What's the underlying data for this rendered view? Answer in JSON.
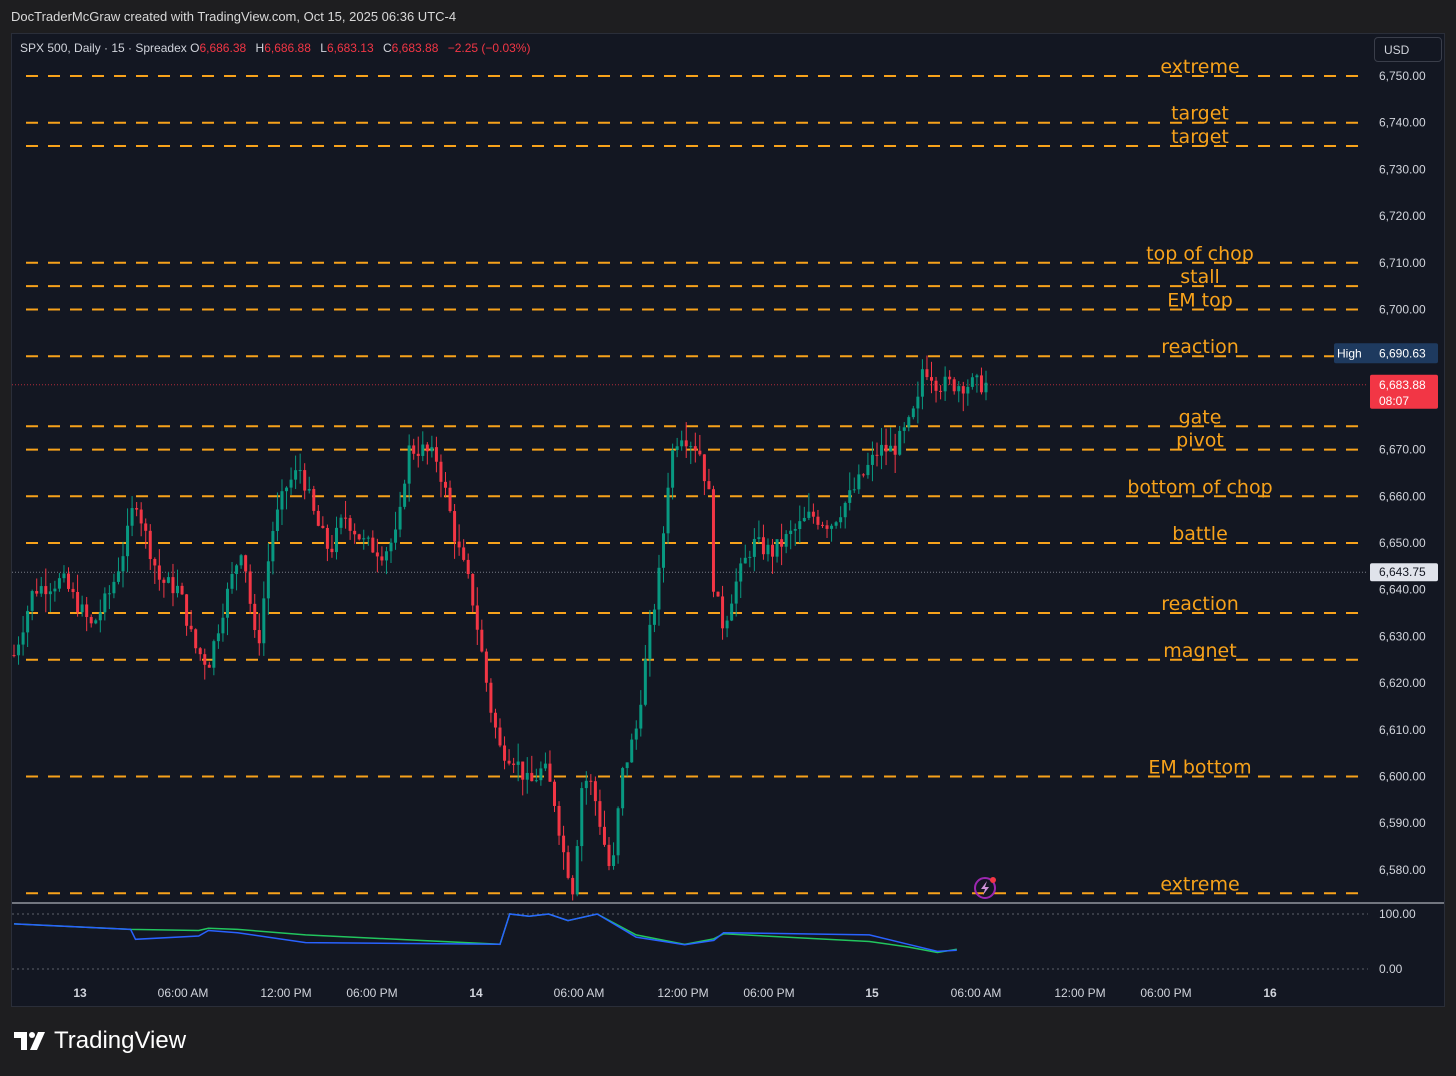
{
  "header": {
    "credit": "DocTraderMcGraw created with TradingView.com, Oct 15, 2025 06:36 UTC-4"
  },
  "legend": {
    "symbol": "SPX 500, Daily · 15 · Spreadex",
    "o_label": "O",
    "o_value": "6,686.38",
    "h_label": "H",
    "h_value": "6,686.88",
    "l_label": "L",
    "l_value": "6,683.13",
    "c_label": "C",
    "c_value": "6,683.88",
    "change": "−2.25 (−0.03%)"
  },
  "currency_button": "USD",
  "footer": {
    "brand": "TradingView"
  },
  "colors": {
    "level_line": "#f7a21b",
    "up_candle": "#089981",
    "down_candle": "#f23645",
    "osc_green": "#22c55e",
    "osc_blue": "#2962ff",
    "high_badge": "#1e3a5f",
    "last_badge": "#f23645"
  },
  "chart_data": {
    "type": "candlestick",
    "title": "SPX 500, Daily · 15 · Spreadex",
    "y_axis": {
      "ticks": [
        "6,750.00",
        "6,740.00",
        "6,730.00",
        "6,720.00",
        "6,710.00",
        "6,700.00",
        "6,690.00",
        "6,680.00",
        "6,670.00",
        "6,660.00",
        "6,650.00",
        "6,640.00",
        "6,630.00",
        "6,620.00",
        "6,610.00",
        "6,600.00",
        "6,590.00",
        "6,580.00"
      ],
      "range": [
        6574,
        6753
      ]
    },
    "x_axis": {
      "ticks": [
        "13",
        "06:00 AM",
        "12:00 PM",
        "06:00 PM",
        "14",
        "06:00 AM",
        "12:00 PM",
        "06:00 PM",
        "15",
        "06:00 AM",
        "12:00 PM",
        "06:00 PM",
        "16"
      ]
    },
    "levels": [
      {
        "label": "extreme",
        "price": 6750
      },
      {
        "label": "target",
        "price": 6740
      },
      {
        "label": "target",
        "price": 6735
      },
      {
        "label": "top of chop",
        "price": 6710
      },
      {
        "label": "stall",
        "price": 6705
      },
      {
        "label": "EM top",
        "price": 6700
      },
      {
        "label": "reaction",
        "price": 6690
      },
      {
        "label": "gate",
        "price": 6675
      },
      {
        "label": "pivot",
        "price": 6670
      },
      {
        "label": "bottom of chop",
        "price": 6660
      },
      {
        "label": "battle",
        "price": 6650
      },
      {
        "label": "reaction",
        "price": 6635
      },
      {
        "label": "magnet",
        "price": 6625
      },
      {
        "label": "EM bottom",
        "price": 6600
      },
      {
        "label": "extreme",
        "price": 6575
      }
    ],
    "price_path": [
      [
        0,
        6626
      ],
      [
        0.02,
        6640
      ],
      [
        0.05,
        6642
      ],
      [
        0.08,
        6632
      ],
      [
        0.1,
        6640
      ],
      [
        0.115,
        6650
      ],
      [
        0.125,
        6660
      ],
      [
        0.135,
        6652
      ],
      [
        0.15,
        6642
      ],
      [
        0.17,
        6640
      ],
      [
        0.185,
        6628
      ],
      [
        0.2,
        6624
      ],
      [
        0.215,
        6636
      ],
      [
        0.235,
        6650
      ],
      [
        0.25,
        6626
      ],
      [
        0.265,
        6652
      ],
      [
        0.28,
        6662
      ],
      [
        0.295,
        6666
      ],
      [
        0.31,
        6655
      ],
      [
        0.325,
        6648
      ],
      [
        0.34,
        6656
      ],
      [
        0.36,
        6650
      ],
      [
        0.38,
        6648
      ],
      [
        0.395,
        6652
      ],
      [
        0.405,
        6670
      ],
      [
        0.42,
        6670
      ],
      [
        0.435,
        6668
      ],
      [
        0.445,
        6660
      ],
      [
        0.455,
        6650
      ],
      [
        0.47,
        6640
      ],
      [
        0.48,
        6628
      ],
      [
        0.49,
        6615
      ],
      [
        0.5,
        6606
      ],
      [
        0.515,
        6604
      ],
      [
        0.53,
        6598
      ],
      [
        0.545,
        6602
      ],
      [
        0.555,
        6596
      ],
      [
        0.565,
        6584
      ],
      [
        0.575,
        6576
      ],
      [
        0.585,
        6600
      ],
      [
        0.595,
        6598
      ],
      [
        0.605,
        6588
      ],
      [
        0.615,
        6578
      ],
      [
        0.625,
        6600
      ],
      [
        0.64,
        6610
      ],
      [
        0.65,
        6625
      ],
      [
        0.665,
        6645
      ],
      [
        0.675,
        6668
      ],
      [
        0.685,
        6674
      ],
      [
        0.695,
        6672
      ],
      [
        0.705,
        6670
      ],
      [
        0.715,
        6660
      ],
      [
        0.72,
        6640
      ],
      [
        0.73,
        6632
      ],
      [
        0.74,
        6640
      ],
      [
        0.76,
        6650
      ],
      [
        0.78,
        6648
      ],
      [
        0.8,
        6652
      ],
      [
        0.82,
        6656
      ],
      [
        0.84,
        6654
      ],
      [
        0.86,
        6660
      ],
      [
        0.875,
        6665
      ],
      [
        0.89,
        6670
      ],
      [
        0.905,
        6670
      ],
      [
        0.92,
        6675
      ],
      [
        0.93,
        6680
      ],
      [
        0.935,
        6688
      ],
      [
        0.945,
        6686
      ],
      [
        0.95,
        6684
      ]
    ],
    "price_path_x_unit": "fraction of the plotted data span",
    "current_price": {
      "value": "6,683.88",
      "countdown": "08:07"
    },
    "high_marker": {
      "label": "High",
      "value": "6,690.63"
    },
    "crosshair_price": "6,643.75",
    "oscillator": {
      "ticks": [
        "100.00",
        "0.00"
      ],
      "range": [
        0,
        100
      ],
      "series": [
        {
          "color": "green",
          "values": [
            [
              0,
              82
            ],
            [
              0.12,
              72
            ],
            [
              0.19,
              70
            ],
            [
              0.2,
              74
            ],
            [
              0.23,
              72
            ],
            [
              0.3,
              62
            ],
            [
              0.5,
              45
            ],
            [
              0.51,
              100
            ],
            [
              0.53,
              96
            ],
            [
              0.55,
              100
            ],
            [
              0.57,
              88
            ],
            [
              0.6,
              100
            ],
            [
              0.64,
              62
            ],
            [
              0.69,
              45
            ],
            [
              0.72,
              55
            ],
            [
              0.73,
              64
            ],
            [
              0.88,
              50
            ],
            [
              0.92,
              40
            ],
            [
              0.95,
              30
            ],
            [
              0.97,
              36
            ]
          ]
        },
        {
          "color": "blue",
          "values": [
            [
              0,
              82
            ],
            [
              0.12,
              72
            ],
            [
              0.125,
              54
            ],
            [
              0.19,
              60
            ],
            [
              0.2,
              70
            ],
            [
              0.23,
              66
            ],
            [
              0.3,
              48
            ],
            [
              0.5,
              45
            ],
            [
              0.51,
              100
            ],
            [
              0.53,
              96
            ],
            [
              0.55,
              100
            ],
            [
              0.57,
              88
            ],
            [
              0.6,
              100
            ],
            [
              0.64,
              58
            ],
            [
              0.69,
              44
            ],
            [
              0.72,
              52
            ],
            [
              0.73,
              66
            ],
            [
              0.88,
              62
            ],
            [
              0.92,
              45
            ],
            [
              0.95,
              32
            ],
            [
              0.97,
              34
            ]
          ]
        }
      ]
    }
  }
}
